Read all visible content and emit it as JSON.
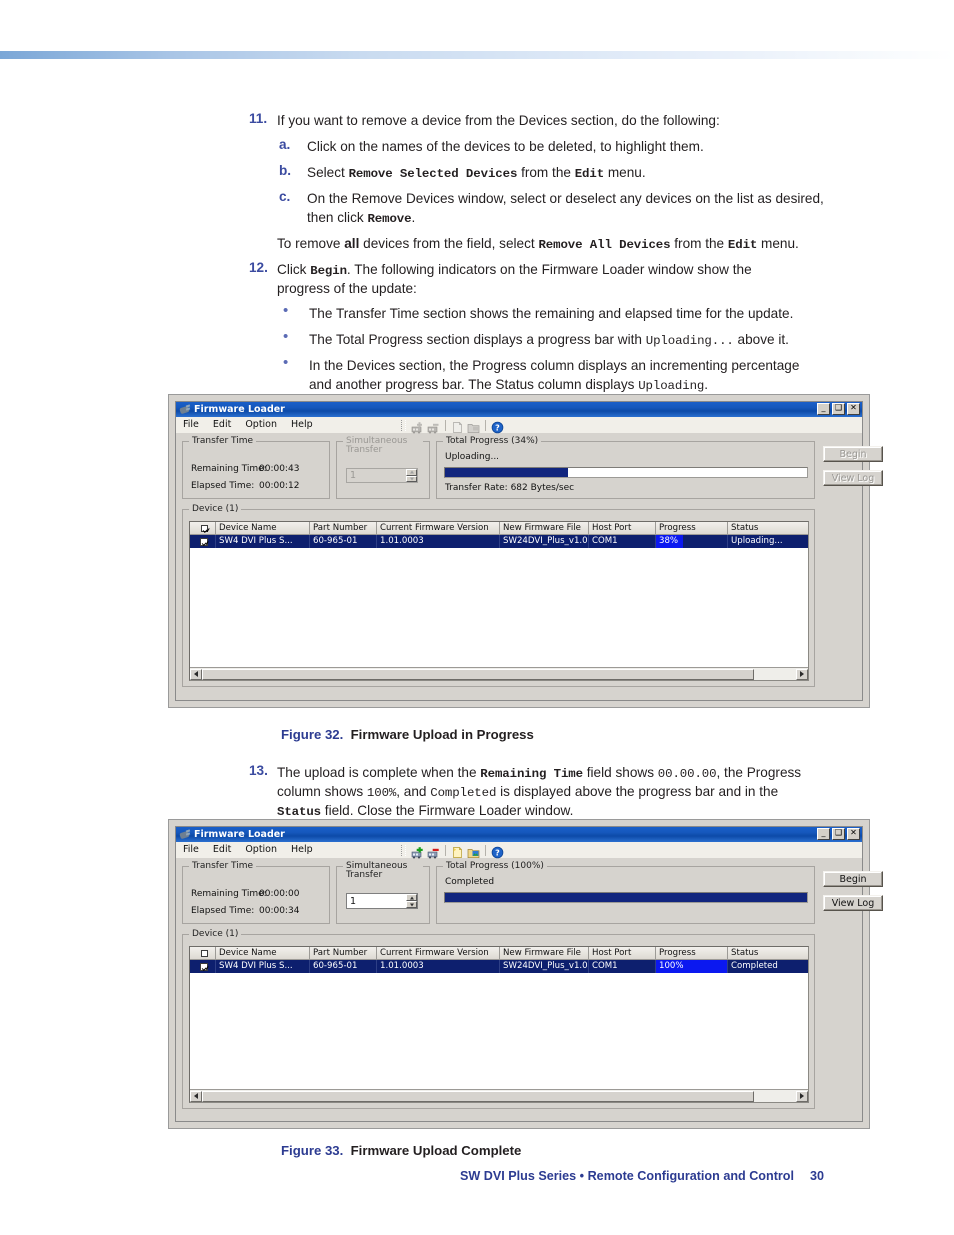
{
  "page": {
    "footer_title": "SW DVI Plus Series • Remote Configuration and Control",
    "page_number": "30"
  },
  "steps": {
    "s11": {
      "num": "11.",
      "text": "If you want to remove a device from the Devices section, do the following:",
      "a": {
        "label": "a.",
        "text": "Click on the names of the devices to be deleted, to highlight them."
      },
      "b": {
        "label": "b.",
        "pre": "Select ",
        "cmd": "Remove Selected Devices",
        "mid": " from the ",
        "menu": "Edit",
        "post": " menu."
      },
      "c": {
        "label": "c.",
        "line1": "On the Remove Devices window, select or deselect any devices on the list as desired,",
        "line2_pre": "then click ",
        "line2_cmd": "Remove",
        "line2_post": "."
      },
      "note_pre": "To remove ",
      "note_all": "all",
      "note_mid": " devices from the field, select ",
      "note_cmd": "Remove All Devices",
      "note_mid2": " from the ",
      "note_menu": "Edit",
      "note_post": " menu."
    },
    "s12": {
      "num": "12.",
      "pre": "Click ",
      "cmd": "Begin",
      "post": ". The following indicators on the Firmware Loader window show the",
      "line2": "progress of the update:",
      "bullets": [
        {
          "text": "The Transfer Time section shows the remaining and elapsed time for the update."
        },
        {
          "pre": "The Total Progress section displays a progress bar with ",
          "cmd": "Uploading...",
          "post": " above it."
        },
        {
          "line1": "In the Devices section, the Progress column displays an incrementing percentage",
          "line2_pre": "and another progress bar. The Status column displays ",
          "line2_cmd": "Uploading",
          "line2_post": "."
        }
      ]
    },
    "s13": {
      "num": "13.",
      "l1_pre": "The upload is complete when the ",
      "l1_cmd": "Remaining Time",
      "l1_mid": " field shows ",
      "l1_val": "00.00.00",
      "l1_post": ", the Progress",
      "l2_pre": "column shows ",
      "l2_val": "100%",
      "l2_mid": ", and ",
      "l2_cmd": "Completed",
      "l2_post": " is displayed above the progress bar and in the",
      "l3_cmd": "Status",
      "l3_post": " field. Close the Firmware Loader window."
    }
  },
  "figures": [
    {
      "num": "Figure 32.",
      "title": "Firmware Upload in Progress"
    },
    {
      "num": "Figure 33.",
      "title": "Firmware Upload Complete"
    }
  ],
  "window_common": {
    "title": "Firmware Loader",
    "titlebar_icon": "plug-icon",
    "window_buttons": {
      "minimize": "_",
      "maximize": "❑",
      "close": "✕"
    },
    "menus": [
      "File",
      "Edit",
      "Option",
      "Help"
    ],
    "toolbar_icons": [
      "add-device-icon",
      "remove-device-icon",
      "new-file-icon",
      "open-file-icon",
      "help-icon"
    ],
    "groups": {
      "transfer_time": "Transfer Time",
      "simultaneous_transfer": "Simultaneous Transfer",
      "device": "Device (1)"
    },
    "labels": {
      "remaining_time": "Remaining Time:",
      "elapsed_time": "Elapsed Time:"
    },
    "buttons": {
      "begin": "Begin",
      "view_log": "View Log"
    },
    "columns": [
      "",
      "Device Name",
      "Part Number",
      "Current Firmware Version",
      "New Firmware File",
      "Host Port",
      "Progress",
      "Status"
    ]
  },
  "window1": {
    "remaining_time": "00:00:43",
    "elapsed_time": "00:00:12",
    "simultaneous_value": "1",
    "simultaneous_enabled": false,
    "total_progress_label": "Total Progress (34%)",
    "progress_status": "Uploading...",
    "progress_percent": 34,
    "transfer_rate": "Transfer Rate: 682 Bytes/sec",
    "begin_enabled": false,
    "view_log_enabled": false,
    "toolbar_enabled": false,
    "row": {
      "checked": true,
      "device_name": "SW4 DVI Plus S...",
      "part_number": "60-965-01",
      "current_firmware": "1.01.0003",
      "new_firmware_file": "SW24DVI_Plus_v1.0...",
      "host_port": "COM1",
      "progress": "38%",
      "progress_percent": 38,
      "status": "Uploading..."
    },
    "header_checkbox": true
  },
  "window2": {
    "remaining_time": "00:00:00",
    "elapsed_time": "00:00:34",
    "simultaneous_value": "1",
    "simultaneous_enabled": true,
    "total_progress_label": "Total Progress (100%)",
    "progress_status": "Completed",
    "progress_percent": 100,
    "transfer_rate": "",
    "begin_enabled": true,
    "view_log_enabled": true,
    "toolbar_enabled": true,
    "row": {
      "checked": true,
      "device_name": "SW4 DVI Plus S...",
      "part_number": "60-965-01",
      "current_firmware": "1.01.0003",
      "new_firmware_file": "SW24DVI_Plus_v1.0...",
      "host_port": "COM1",
      "progress": "100%",
      "progress_percent": 100,
      "status": "Completed"
    },
    "header_checkbox": false
  },
  "colors": {
    "accent_blue": "#2c3b91",
    "progress_fill": "#11257e",
    "row_selected": "#0d1f6e",
    "cell_progress": "#0b18f0"
  }
}
